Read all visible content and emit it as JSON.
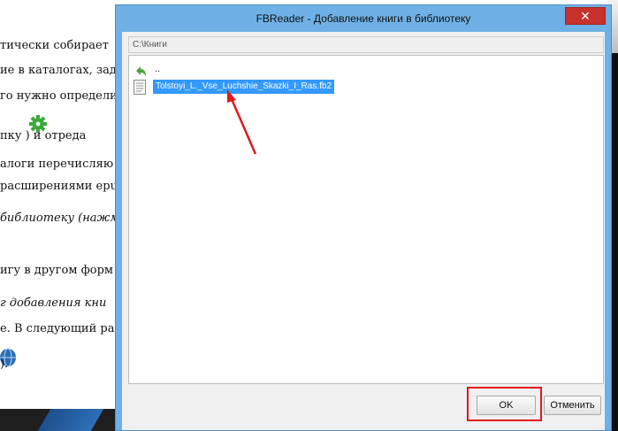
{
  "background_doc": {
    "lines": [
      "тически собирает",
      "ие в каталогах, зад",
      "го нужно определи",
      "пку      ) и отреда",
      "алоги перечисляю",
      "расширениями epu",
      "библиотеку (нажм",
      "игу в другом форм",
      "г добавления кни",
      "е. В следующий ра",
      "   )."
    ]
  },
  "dialog": {
    "title": "FBReader - Добавление книги в библиотеку",
    "close_glyph": "✕",
    "path": "C:\\Книги",
    "up_label": "..",
    "files": [
      {
        "name": "Tolstoyi_L._Vse_Luchshie_Skazki_I_Ras.fb2",
        "selected": true
      }
    ],
    "buttons": {
      "ok": "OK",
      "cancel": "Отменить"
    },
    "colors": {
      "window_frame": "#6fb1e6",
      "selection": "#3399ff",
      "close_button": "#c7312e",
      "annotation": "#e0191b"
    }
  }
}
